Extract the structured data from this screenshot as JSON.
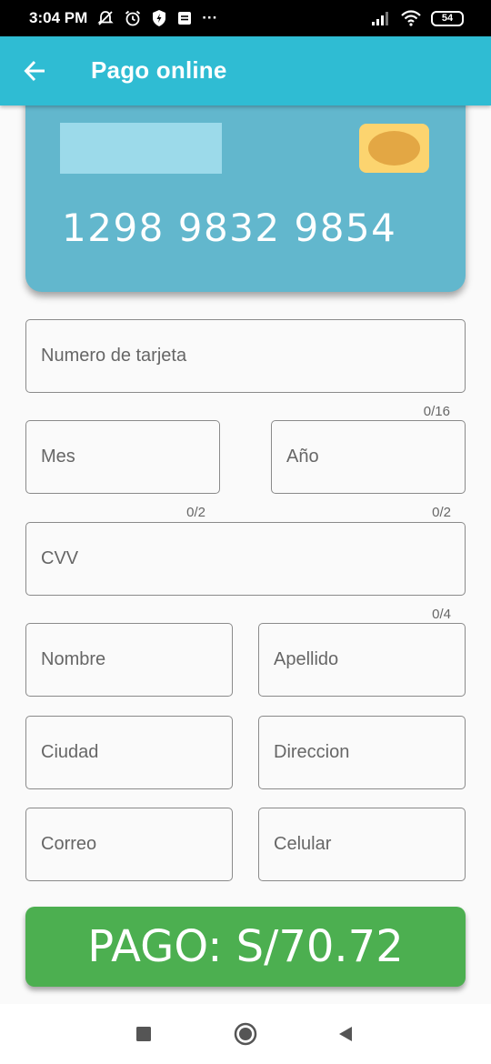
{
  "status_bar": {
    "time": "3:04 PM",
    "more": "···",
    "battery": "54"
  },
  "app_bar": {
    "title": "Pago online",
    "back_icon": "arrow-back-icon"
  },
  "card": {
    "number": "1298 9832 9854",
    "stripe_color": "#9cdaea",
    "chip_color": "#fcd46f",
    "card_color": "#62b7cd"
  },
  "form": {
    "card_number": {
      "label": "Numero de tarjeta",
      "counter": "0/16"
    },
    "month": {
      "label": "Mes",
      "counter": "0/2"
    },
    "year": {
      "label": "Año",
      "counter": "0/2"
    },
    "cvv": {
      "label": "CVV",
      "counter": "0/4"
    },
    "first_name": {
      "label": "Nombre"
    },
    "last_name": {
      "label": "Apellido"
    },
    "city": {
      "label": "Ciudad"
    },
    "address": {
      "label": "Direccion"
    },
    "email": {
      "label": "Correo"
    },
    "phone": {
      "label": "Celular"
    }
  },
  "pay_button": {
    "label": "PAGO: S/70.72",
    "color": "#4caf50"
  },
  "colors": {
    "accent": "#2fbcd3",
    "field_border": "#8a8a8a"
  },
  "nav": {
    "recents_icon": "square-icon",
    "home_icon": "circle-icon",
    "back_icon": "triangle-back-icon"
  }
}
